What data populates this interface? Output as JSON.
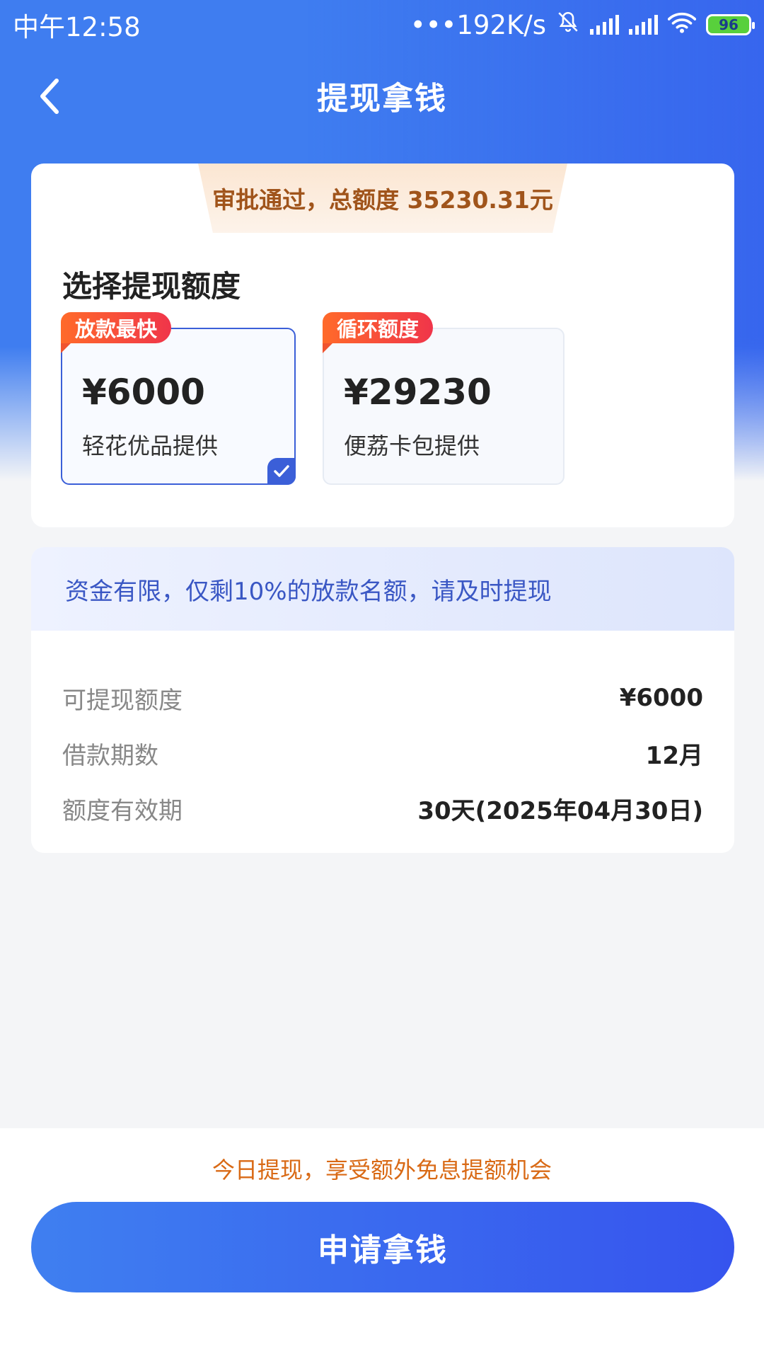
{
  "status_bar": {
    "time": "中午12:58",
    "network_speed": "•••192K/s",
    "battery": "96",
    "icons": [
      "mute-icon",
      "signal-icon",
      "signal-icon",
      "wifi-icon",
      "battery-icon"
    ]
  },
  "nav": {
    "back_icon": "chevron-left-icon",
    "title": "提现拿钱"
  },
  "approval": {
    "text": "审批通过，总额度 35230.31元"
  },
  "select": {
    "title": "选择提现额度",
    "options": [
      {
        "badge": "放款最快",
        "amount": "¥6000",
        "provider": "轻花优品提供",
        "selected": true
      },
      {
        "badge": "循环额度",
        "amount": "¥29230",
        "provider": "便荔卡包提供",
        "selected": false
      }
    ]
  },
  "notice": {
    "text": "资金有限，仅剩10%的放款名额，请及时提现"
  },
  "details": [
    {
      "label": "可提现额度",
      "value": "¥6000"
    },
    {
      "label": "借款期数",
      "value": "12月"
    },
    {
      "label": "额度有效期",
      "value": "30天(2025年04月30日)"
    }
  ],
  "footer": {
    "promo": "今日提现，享受额外免息提额机会",
    "button": "申请拿钱"
  },
  "colors": {
    "primary": "#3f6ff0",
    "badge": "#f0354a",
    "promo": "#d96a16",
    "approval_text": "#a0541b"
  }
}
